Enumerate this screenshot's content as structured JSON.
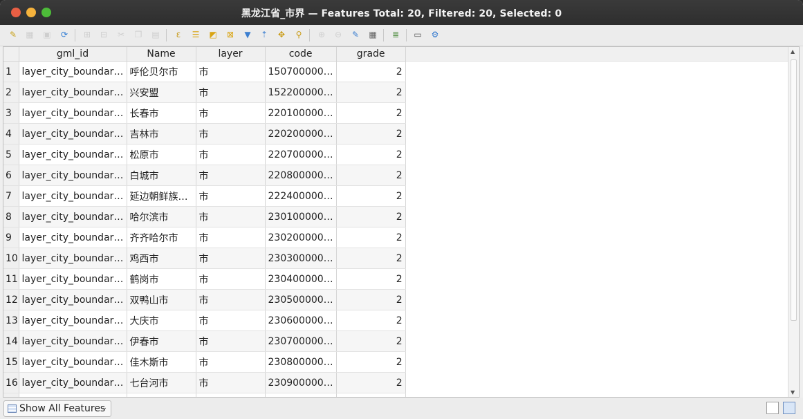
{
  "window": {
    "title": "黑龙江省_市界 — Features Total: 20, Filtered: 20, Selected: 0"
  },
  "toolbar": {
    "buttons": [
      {
        "name": "toggle-editing-icon",
        "glyph": "✎",
        "color": "#c9a21a",
        "enabled": true
      },
      {
        "name": "multi-edit-icon",
        "glyph": "▦",
        "color": "#999",
        "enabled": false
      },
      {
        "name": "save-edits-icon",
        "glyph": "▣",
        "color": "#999",
        "enabled": false
      },
      {
        "name": "reload-icon",
        "glyph": "⟳",
        "color": "#2d7bd4",
        "enabled": true
      },
      {
        "name": "add-feature-icon",
        "glyph": "⊞",
        "color": "#999",
        "enabled": false
      },
      {
        "name": "delete-feature-icon",
        "glyph": "⊟",
        "color": "#999",
        "enabled": false
      },
      {
        "name": "cut-icon",
        "glyph": "✂",
        "color": "#999",
        "enabled": false
      },
      {
        "name": "copy-icon",
        "glyph": "❐",
        "color": "#999",
        "enabled": false
      },
      {
        "name": "paste-icon",
        "glyph": "▤",
        "color": "#999",
        "enabled": false
      },
      {
        "name": "select-by-expression-icon",
        "glyph": "ε",
        "color": "#c79a1a",
        "enabled": true
      },
      {
        "name": "select-all-icon",
        "glyph": "☰",
        "color": "#d9a412",
        "enabled": true
      },
      {
        "name": "invert-selection-icon",
        "glyph": "◩",
        "color": "#d9a412",
        "enabled": true
      },
      {
        "name": "deselect-all-icon",
        "glyph": "⊠",
        "color": "#d9a412",
        "enabled": true
      },
      {
        "name": "filter-icon",
        "glyph": "▼",
        "color": "#3c7fd0",
        "enabled": true
      },
      {
        "name": "move-selection-to-top-icon",
        "glyph": "⇡",
        "color": "#3c7fd0",
        "enabled": true
      },
      {
        "name": "pan-to-selection-icon",
        "glyph": "✥",
        "color": "#c99a12",
        "enabled": true
      },
      {
        "name": "zoom-to-selection-icon",
        "glyph": "⚲",
        "color": "#c99a12",
        "enabled": true
      },
      {
        "name": "new-field-icon",
        "glyph": "⊕",
        "color": "#999",
        "enabled": false
      },
      {
        "name": "delete-field-icon",
        "glyph": "⊖",
        "color": "#999",
        "enabled": false
      },
      {
        "name": "organize-columns-icon",
        "glyph": "✎",
        "color": "#3c7fd0",
        "enabled": true
      },
      {
        "name": "field-calculator-icon",
        "glyph": "▦",
        "color": "#666",
        "enabled": true
      },
      {
        "name": "conditional-formatting-icon",
        "glyph": "≣",
        "color": "#4a8a3a",
        "enabled": true
      },
      {
        "name": "dock-icon",
        "glyph": "▭",
        "color": "#555",
        "enabled": true
      },
      {
        "name": "actions-icon",
        "glyph": "⚙",
        "color": "#3c7fd0",
        "enabled": true
      }
    ]
  },
  "table": {
    "columns": [
      "gml_id",
      "Name",
      "layer",
      "code",
      "grade"
    ],
    "rows": [
      {
        "n": "1",
        "gml_id": "layer_city_boundar…",
        "name": "呼伦贝尔市",
        "layer": "市",
        "code": "150700000…",
        "grade": "2"
      },
      {
        "n": "2",
        "gml_id": "layer_city_boundar…",
        "name": "兴安盟",
        "layer": "市",
        "code": "152200000…",
        "grade": "2"
      },
      {
        "n": "3",
        "gml_id": "layer_city_boundar…",
        "name": "长春市",
        "layer": "市",
        "code": "220100000…",
        "grade": "2"
      },
      {
        "n": "4",
        "gml_id": "layer_city_boundar…",
        "name": "吉林市",
        "layer": "市",
        "code": "220200000…",
        "grade": "2"
      },
      {
        "n": "5",
        "gml_id": "layer_city_boundar…",
        "name": "松原市",
        "layer": "市",
        "code": "220700000…",
        "grade": "2"
      },
      {
        "n": "6",
        "gml_id": "layer_city_boundar…",
        "name": "白城市",
        "layer": "市",
        "code": "220800000…",
        "grade": "2"
      },
      {
        "n": "7",
        "gml_id": "layer_city_boundar…",
        "name": "延边朝鲜族…",
        "layer": "市",
        "code": "222400000…",
        "grade": "2"
      },
      {
        "n": "8",
        "gml_id": "layer_city_boundar…",
        "name": "哈尔滨市",
        "layer": "市",
        "code": "230100000…",
        "grade": "2"
      },
      {
        "n": "9",
        "gml_id": "layer_city_boundar…",
        "name": "齐齐哈尔市",
        "layer": "市",
        "code": "230200000…",
        "grade": "2"
      },
      {
        "n": "10",
        "gml_id": "layer_city_boundar…",
        "name": "鸡西市",
        "layer": "市",
        "code": "230300000…",
        "grade": "2"
      },
      {
        "n": "11",
        "gml_id": "layer_city_boundar…",
        "name": "鹤岗市",
        "layer": "市",
        "code": "230400000…",
        "grade": "2"
      },
      {
        "n": "12",
        "gml_id": "layer_city_boundar…",
        "name": "双鸭山市",
        "layer": "市",
        "code": "230500000…",
        "grade": "2"
      },
      {
        "n": "13",
        "gml_id": "layer_city_boundar…",
        "name": "大庆市",
        "layer": "市",
        "code": "230600000…",
        "grade": "2"
      },
      {
        "n": "14",
        "gml_id": "layer_city_boundar…",
        "name": "伊春市",
        "layer": "市",
        "code": "230700000…",
        "grade": "2"
      },
      {
        "n": "15",
        "gml_id": "layer_city_boundar…",
        "name": "佳木斯市",
        "layer": "市",
        "code": "230800000…",
        "grade": "2"
      },
      {
        "n": "16",
        "gml_id": "layer_city_boundar…",
        "name": "七台河市",
        "layer": "市",
        "code": "230900000…",
        "grade": "2"
      }
    ]
  },
  "bottom": {
    "filter_label": "Show All Features",
    "view_buttons": [
      "form-view-icon",
      "table-view-icon"
    ]
  }
}
